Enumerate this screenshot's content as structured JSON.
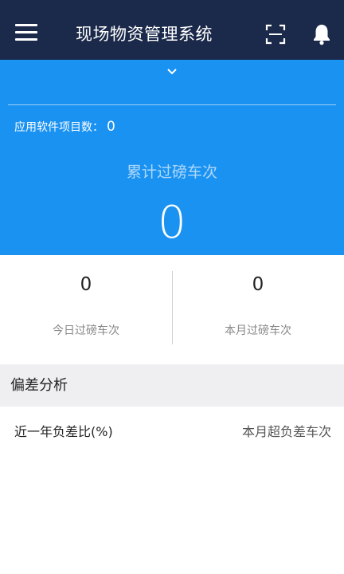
{
  "app_bar": {
    "title": "现场物资管理系统",
    "background_color": "#1b2a4a",
    "icons": [
      "menu-icon",
      "scan-icon",
      "bell-icon"
    ]
  },
  "summary": {
    "background_color": "#1a92f2",
    "project_count_label": "应用软件项目数：",
    "project_count_value": "0",
    "total_label": "累计过磅车次",
    "total_value": "0"
  },
  "stats": [
    {
      "value": "0",
      "label": "今日过磅车次"
    },
    {
      "value": "0",
      "label": "本月过磅车次"
    }
  ],
  "deviation": {
    "section_title": "偏差分析",
    "row_left": "近一年负差比(%)",
    "row_right": "本月超负差车次"
  }
}
